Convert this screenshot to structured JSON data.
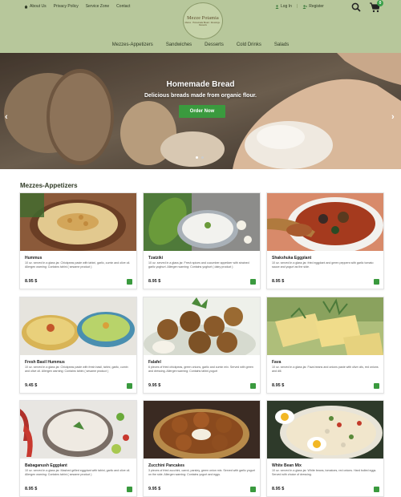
{
  "colors": {
    "header_bg": "#b7c79b",
    "accent_green": "#3a9a3e",
    "nav_text": "#2f3a25"
  },
  "topnav": [
    {
      "label": "About Us",
      "icon": "home-icon"
    },
    {
      "label": "Privacy Policy"
    },
    {
      "label": "Service Zone"
    },
    {
      "label": "Contact"
    }
  ],
  "logo": {
    "name": "Mezze Potamia",
    "tagline": "Mezes · Homemade Bread · Dressings · Desserts"
  },
  "auth": {
    "login": "Log In",
    "register": "Register",
    "separator": "|"
  },
  "cart": {
    "count": "0"
  },
  "mainnav": [
    "Mezzes-Appetizers",
    "Sandwiches",
    "Desserts",
    "Cold Drinks",
    "Salads"
  ],
  "hero": {
    "title": "Homemade Bread",
    "subtitle": "Delicious breads made from organic flour.",
    "button": "Order Now",
    "prev": "‹",
    "next": "›"
  },
  "section": {
    "title": "Mezzes-Appetizers"
  },
  "products": [
    {
      "name": "Hummus",
      "desc": "10 oz. served in a glass jar. Chickpeas paste with tahini, garlic, cumin and olive oil. Allergen warning: Contains tahini ( sesame product )",
      "price": "8.95 $",
      "photo": "hummus"
    },
    {
      "name": "Tzatziki",
      "desc": "10 oz. served in a glass jar. Fresh spices and cucumber appetizer with strained garlic yoghurt. Allergen warning: Contains yoghurt ( dairy product )",
      "price": "8.95 $",
      "photo": "tzatziki"
    },
    {
      "name": "Shakshuka Eggplant",
      "desc": "10 oz. served in a glass jar. fried eggplant and green peppers with garlic tomato sauce and yogurt as the side.",
      "price": "8.95 $",
      "photo": "shakshuka"
    },
    {
      "name": "Fresh Basil Hummus",
      "desc": "10 oz. served in a glass jar. Chickpeas paste with fresh basil, tahini, garlic, cumin and olive oil. Allergen warning: Contains tahini ( sesame product )",
      "price": "9.45 $",
      "photo": "basil-hummus"
    },
    {
      "name": "Falafel",
      "desc": "6 pieces of fried chickpeas, green onions, garlic and cumin mix. Served with green and dressing. Allergen warning: Contains tahini,yogurt",
      "price": "9.95 $",
      "photo": "falafel"
    },
    {
      "name": "Fava",
      "desc": "10 oz. served in a glass jar. Fava beans and onions paste with olive oils, red onions and dill.",
      "price": "8.95 $",
      "photo": "fava"
    },
    {
      "name": "Babaganush Eggplant",
      "desc": "10 oz. served in a glass jar. Mashed grilled eggplant with tahini, garlic and olive oil. Allergen warning: Contains tahini ( sesame product )",
      "price": "8.95 $",
      "photo": "babaganush"
    },
    {
      "name": "Zucchini Pancakes",
      "desc": "3 pieces of fried zucchini, carrot, parsley, green onion mix. Served with garlic yogurt on the side. Allergen warning: Contains yogurt and eggs.",
      "price": "9.95 $",
      "photo": "zucchini"
    },
    {
      "name": "White Bean Mix",
      "desc": "10 oz. served in a glass jar. White beans, tomatoes, red onions. Hard boiled eggs. Served with choice of dressing.",
      "price": "8.95 $",
      "photo": "white-bean"
    }
  ]
}
